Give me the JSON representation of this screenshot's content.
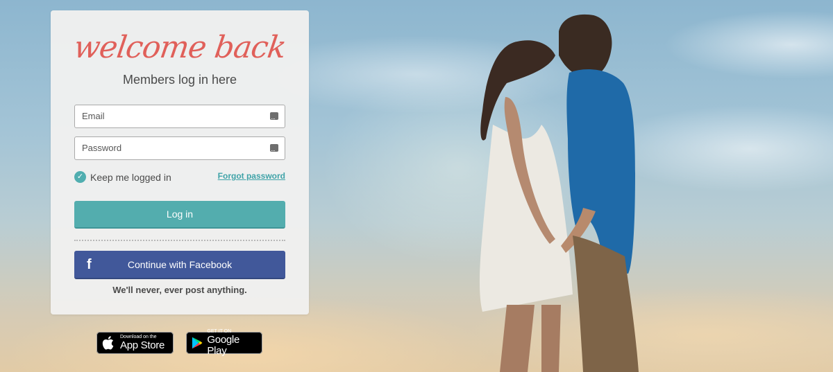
{
  "login_card": {
    "heading": "welcome back",
    "subtitle": "Members log in here",
    "email": {
      "placeholder": "Email",
      "value": ""
    },
    "password": {
      "placeholder": "Password",
      "value": ""
    },
    "remember_me": {
      "label": "Keep me logged in",
      "checked": true
    },
    "forgot_password_label": "Forgot password",
    "login_button_label": "Log in",
    "facebook_button_label": "Continue with Facebook",
    "disclaimer": "We'll never, ever post anything."
  },
  "app_badges": {
    "app_store": {
      "small": "Download on the",
      "big": "App Store"
    },
    "google_play": {
      "small": "GET IT ON",
      "big": "Google Play"
    }
  },
  "colors": {
    "heading": "#e0605a",
    "teal_accent": "#53adae",
    "facebook": "#41589a"
  }
}
